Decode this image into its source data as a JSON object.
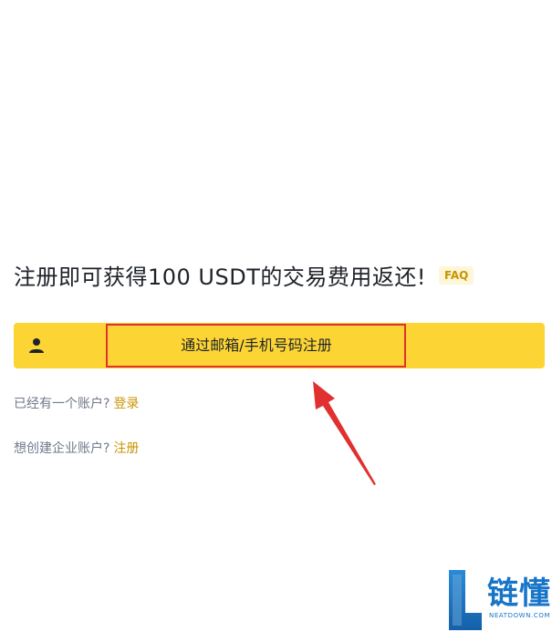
{
  "headline": {
    "text": "注册即可获得100 USDT的交易费用返还!",
    "faq_label": "FAQ"
  },
  "signup": {
    "icon": "person-icon",
    "label": "通过邮箱/手机号码注册",
    "bar_color": "#fcd535"
  },
  "login_row": {
    "prompt": "已经有一个账户?",
    "link": "登录"
  },
  "enterprise_row": {
    "prompt": "想创建企业账户?",
    "link": "注册"
  },
  "annotation": {
    "color": "#e0302f"
  },
  "watermark": {
    "name": "链懂",
    "domain": "NEATDOWN.COM"
  },
  "colors": {
    "accent": "#fcd535",
    "link": "#c99400",
    "muted": "#707a8a",
    "text": "#1e2329"
  }
}
